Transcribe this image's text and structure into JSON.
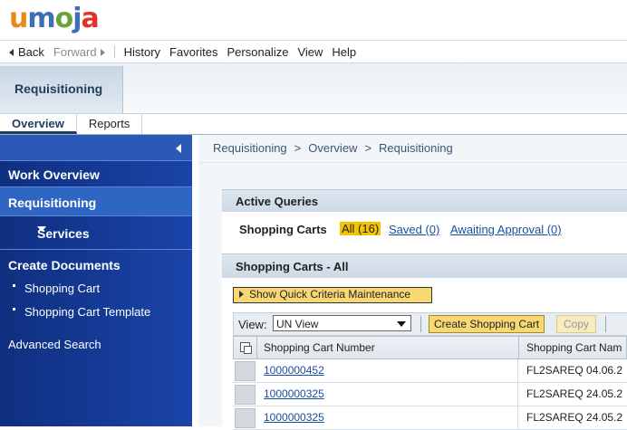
{
  "logo": {
    "u": "u",
    "m": "m",
    "o": "o",
    "j": "j",
    "a": "a"
  },
  "menu": {
    "back": "Back",
    "forward": "Forward",
    "history": "History",
    "favorites": "Favorites",
    "personalize": "Personalize",
    "view": "View",
    "help": "Help"
  },
  "top_tab": "Requisitioning",
  "sub_tabs": [
    "Overview",
    "Reports"
  ],
  "nav": {
    "work_overview": "Work Overview",
    "requisitioning": "Requisitioning",
    "services": "Services",
    "create_documents": "Create Documents",
    "links": [
      "Shopping Cart",
      "Shopping Cart Template"
    ],
    "advanced_search": "Advanced Search"
  },
  "breadcrumb": [
    "Requisitioning",
    ">",
    "Overview",
    ">",
    "Requisitioning"
  ],
  "active_queries": {
    "title": "Active Queries",
    "label": "Shopping Carts",
    "all": "All (16)",
    "saved": "Saved (0)",
    "awaiting": "Awaiting Approval (0)"
  },
  "shopping_carts": {
    "title": "Shopping Carts - All",
    "quick_criteria": "Show Quick Criteria Maintenance",
    "view_label": "View:",
    "view_value": "UN View",
    "create_button": "Create Shopping Cart",
    "copy_button": "Copy",
    "columns": [
      "Shopping Cart Number",
      "Shopping Cart Nam"
    ],
    "rows": [
      {
        "number": "1000000452",
        "name": "FL2SAREQ 04.06.2"
      },
      {
        "number": "1000000325",
        "name": "FL2SAREQ 24.05.2"
      },
      {
        "number": "1000000325",
        "name": "FL2SAREQ 24.05.2"
      }
    ]
  },
  "colors": {
    "nav_bg": "#1a44a8",
    "highlight": "#f3c500",
    "button_yellow": "#f7d873",
    "link": "#1a4ea0"
  }
}
